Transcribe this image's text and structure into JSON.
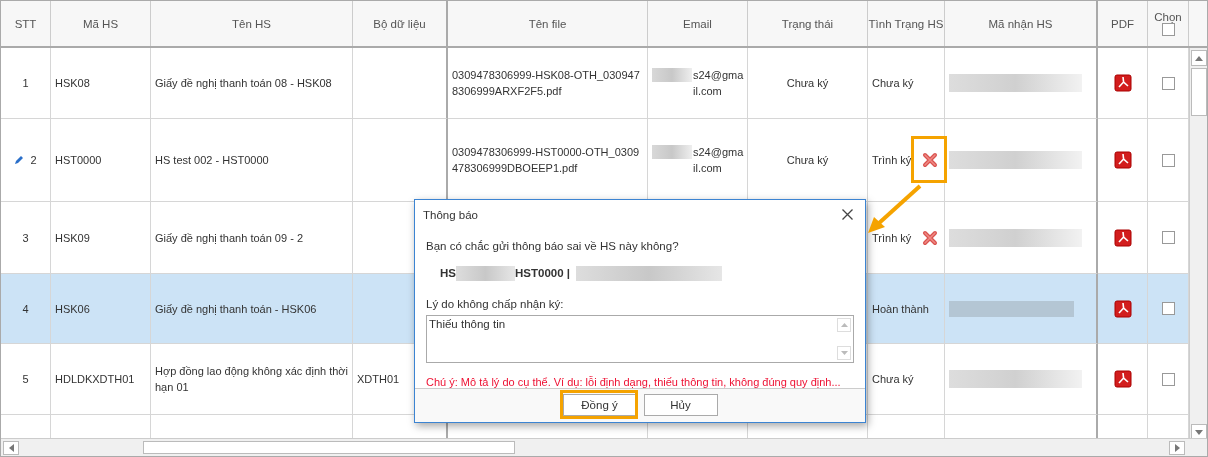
{
  "columns": [
    {
      "label": "STT"
    },
    {
      "label": "Mã HS"
    },
    {
      "label": "Tên HS"
    },
    {
      "label": "Bộ dữ liệu"
    },
    {
      "label": "Tên file"
    },
    {
      "label": "Email"
    },
    {
      "label": "Trạng thái"
    },
    {
      "label": "Tình Trạng HS"
    },
    {
      "label": "Mã nhận HS"
    },
    {
      "label": "PDF"
    },
    {
      "label": "Chọn",
      "checked": false
    }
  ],
  "rows": [
    {
      "stt": "1",
      "ma_hs": "HSK08",
      "ten_hs": "Giấy đề nghị thanh toán 08 - HSK08",
      "ten_file": "0309478306999-HSK08-OTH_0309478306999ARXF2F5.pdf",
      "email": "s24@gmail.com",
      "trang_thai": "Chưa ký",
      "tinh_trang": "Chưa ký",
      "rejected": false,
      "editing": false,
      "selected": false,
      "checked": false
    },
    {
      "stt": "2",
      "ma_hs": "HST0000",
      "ten_hs": "HS test 002 - HST0000",
      "ten_file": "0309478306999-HST0000-OTH_0309478306999DBOEEP1.pdf",
      "email": "s24@gmail.com",
      "trang_thai": "Chưa ký",
      "tinh_trang": "Trình ký",
      "rejected": true,
      "editing": true,
      "selected": false,
      "checked": false
    },
    {
      "stt": "3",
      "ma_hs": "HSK09",
      "ten_hs": "Giấy đề nghị thanh toán 09 - 2",
      "tinh_trang": "Trình ký",
      "rejected": true,
      "editing": false,
      "selected": false,
      "checked": false
    },
    {
      "stt": "4",
      "ma_hs": "HSK06",
      "ten_hs": "Giấy đề nghị thanh toán - HSK06",
      "tinh_trang": "Hoàn thành",
      "rejected": false,
      "editing": false,
      "selected": true,
      "checked": false
    },
    {
      "stt": "5",
      "ma_hs": "HDLDKXDTH01",
      "ten_hs": "Hợp đồng lao động không xác định thời hạn 01",
      "bo_du_lieu": "XDTH01",
      "tinh_trang": "Chưa ký",
      "rejected": false,
      "editing": false,
      "selected": false,
      "checked": false
    }
  ],
  "dialog": {
    "title": "Thông báo",
    "question": "Bạn có chắc gửi thông báo sai về HS này không?",
    "record_prefix": "HS",
    "record_code": "HST0000 |",
    "reason_label": "Lý do không chấp nhận ký:",
    "reason_value": "Thiếu thông tin",
    "note": "Chú ý: Mô tả lý do cụ thể. Ví dụ: lỗi định dạng, thiếu thông tin, không đúng quy định...",
    "buttons": [
      {
        "label": "Đồng ý"
      },
      {
        "label": "Hủy"
      }
    ]
  }
}
